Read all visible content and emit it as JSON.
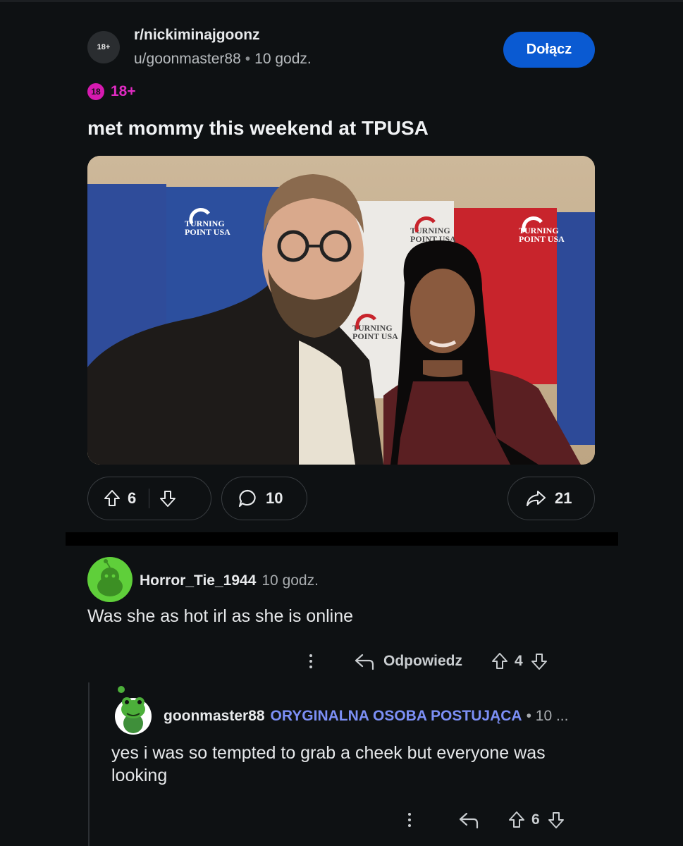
{
  "post": {
    "subreddit_avatar_text": "18+",
    "subreddit": "r/nickiminajgoonz",
    "author": "u/goonmaster88",
    "separator": "•",
    "time": "10 godz.",
    "join_label": "Dołącz",
    "nsfw_icon_text": "18",
    "nsfw_label": "18+",
    "title": "met mommy this weekend at TPUSA",
    "image_banner_text": [
      "TURNING",
      "POINT USA"
    ],
    "votes": "6",
    "comments": "10",
    "shares": "21"
  },
  "comments": [
    {
      "username": "Horror_Tie_1944",
      "time": "10 godz.",
      "body": "Was she as hot irl as she is online",
      "reply_label": "Odpowiedz",
      "votes": "4"
    },
    {
      "username": "goonmaster88",
      "op_label": "ORYGINALNA OSOBA POSTUJĄCA",
      "time_truncated": "• 10 ...",
      "body": "yes i was so tempted to grab a cheek but everyone was looking",
      "votes": "6"
    }
  ],
  "colors": {
    "background": "#0e1113",
    "join_button": "#0a5ad2",
    "nsfw": "#e02bc2",
    "op_label": "#7c8ff5"
  },
  "icons": [
    "upvote-icon",
    "downvote-icon",
    "comment-icon",
    "share-icon",
    "reply-icon",
    "more-options-icon"
  ]
}
